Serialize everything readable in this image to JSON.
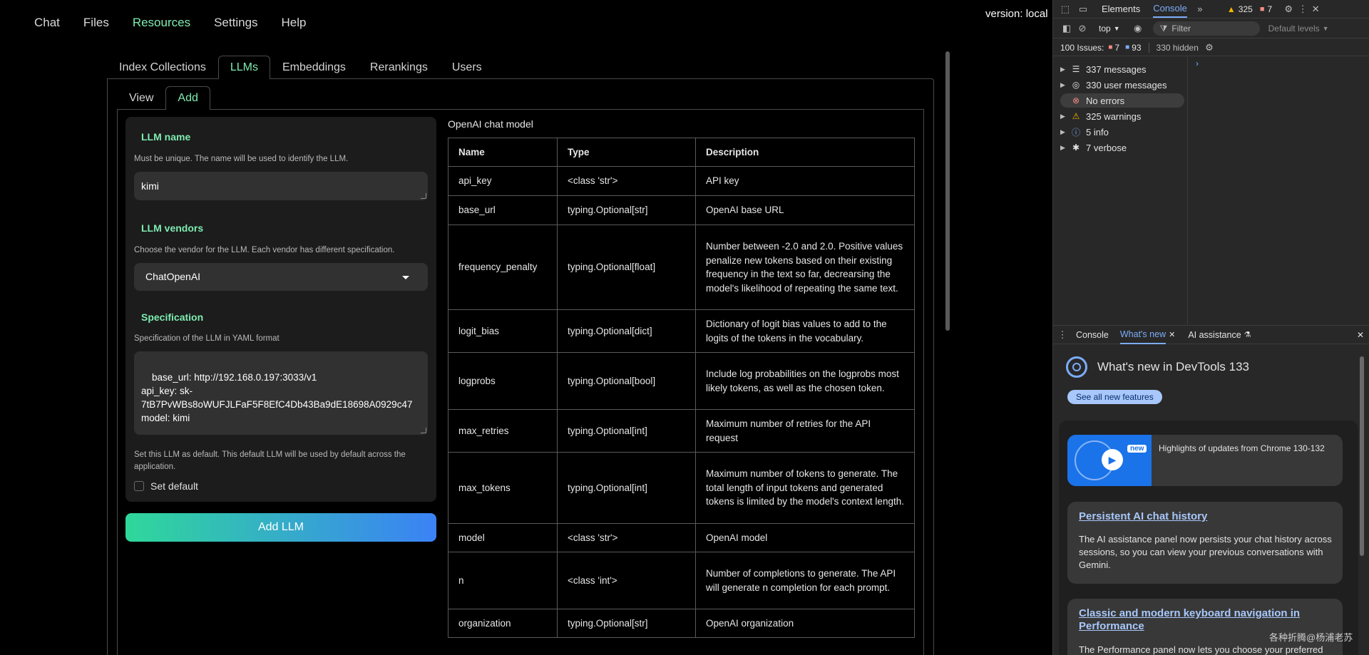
{
  "nav": {
    "items": [
      "Chat",
      "Files",
      "Resources",
      "Settings",
      "Help"
    ],
    "active": "Resources",
    "version": "version: local"
  },
  "resource_tabs": [
    "Index Collections",
    "LLMs",
    "Embeddings",
    "Rerankings",
    "Users"
  ],
  "llm_tabs": [
    "View",
    "Add"
  ],
  "form": {
    "llm_name_label": "LLM name",
    "llm_name_help": "Must be unique. The name will be used to identify the LLM.",
    "llm_name_value": "kimi",
    "vendor_label": "LLM vendors",
    "vendor_help": "Choose the vendor for the LLM. Each vendor has different specification.",
    "vendor_value": "ChatOpenAI",
    "spec_label": "Specification",
    "spec_help": "Specification of the LLM in YAML format",
    "spec_value": "base_url: http://192.168.0.197:3033/v1\napi_key: sk-\n7tB7PvWBs8oWUFJLFaF5F8EfC4Db43Ba9dE18698A0929c47\nmodel: kimi",
    "default_help": "Set this LLM as default. This default LLM will be used by default across the application.",
    "default_label": "Set default",
    "default_checked": false,
    "submit_label": "Add LLM"
  },
  "spec_table": {
    "title": "OpenAI chat model",
    "headers": [
      "Name",
      "Type",
      "Description"
    ],
    "rows": [
      {
        "name": "api_key",
        "type": "<class 'str'>",
        "desc": "API key"
      },
      {
        "name": "base_url",
        "type": "typing.Optional[str]",
        "desc": "OpenAI base URL"
      },
      {
        "name": "frequency_penalty",
        "type": "typing.Optional[float]",
        "desc": "Number between -2.0 and 2.0. Positive values penalize new tokens based on their existing frequency in the text so far, decrearsing the model's likelihood of repeating the same text."
      },
      {
        "name": "logit_bias",
        "type": "typing.Optional[dict]",
        "desc": "Dictionary of logit bias values to add to the logits of the tokens in the vocabulary."
      },
      {
        "name": "logprobs",
        "type": "typing.Optional[bool]",
        "desc": "Include log probabilities on the logprobs most likely tokens, as well as the chosen token."
      },
      {
        "name": "max_retries",
        "type": "typing.Optional[int]",
        "desc": "Maximum number of retries for the API request"
      },
      {
        "name": "max_tokens",
        "type": "typing.Optional[int]",
        "desc": "Maximum number of tokens to generate. The total length of input tokens and generated tokens is limited by the model's context length."
      },
      {
        "name": "model",
        "type": "<class 'str'>",
        "desc": "OpenAI model"
      },
      {
        "name": "n",
        "type": "<class 'int'>",
        "desc": "Number of completions to generate. The API will generate n completion for each prompt."
      },
      {
        "name": "organization",
        "type": "typing.Optional[str]",
        "desc": "OpenAI organization"
      }
    ]
  },
  "devtools": {
    "tabs": [
      "Elements",
      "Console"
    ],
    "active_tab": "Console",
    "warnings_count": "325",
    "errors_count": "7",
    "context": "top",
    "filter_placeholder": "Filter",
    "levels": "Default levels",
    "issues_label": "100 Issues:",
    "issues_errors": "7",
    "issues_info": "93",
    "hidden": "330 hidden",
    "sidebar": [
      {
        "label": "337 messages",
        "icon": "list-icon"
      },
      {
        "label": "330 user messages",
        "icon": "user-icon"
      },
      {
        "label": "No errors",
        "icon": "error-icon"
      },
      {
        "label": "325 warnings",
        "icon": "warning-icon"
      },
      {
        "label": "5 info",
        "icon": "info-icon"
      },
      {
        "label": "7 verbose",
        "icon": "bug-icon"
      }
    ],
    "drawer_tabs": [
      "Console",
      "What's new",
      "AI assistance"
    ],
    "drawer_active": "What's new",
    "whats_new_title": "What's new in DevTools 133",
    "see_all": "See all new features",
    "video_badge": "new",
    "video_caption": "Highlights of updates from Chrome 130-132",
    "cards": [
      {
        "title": "Persistent AI chat history",
        "desc": "The AI assistance panel now persists your chat history across sessions, so you can view your previous conversations with Gemini."
      },
      {
        "title": "Classic and modern keyboard navigation in Performance",
        "desc": "The Performance panel now lets you choose your preferred"
      }
    ]
  },
  "watermark": "各种折腾@杨浦老苏",
  "colors": {
    "accent": "#7eecb1",
    "devtools_link": "#a8c7fa",
    "button_gradient_start": "#2fd89a",
    "button_gradient_end": "#3b82f6"
  }
}
